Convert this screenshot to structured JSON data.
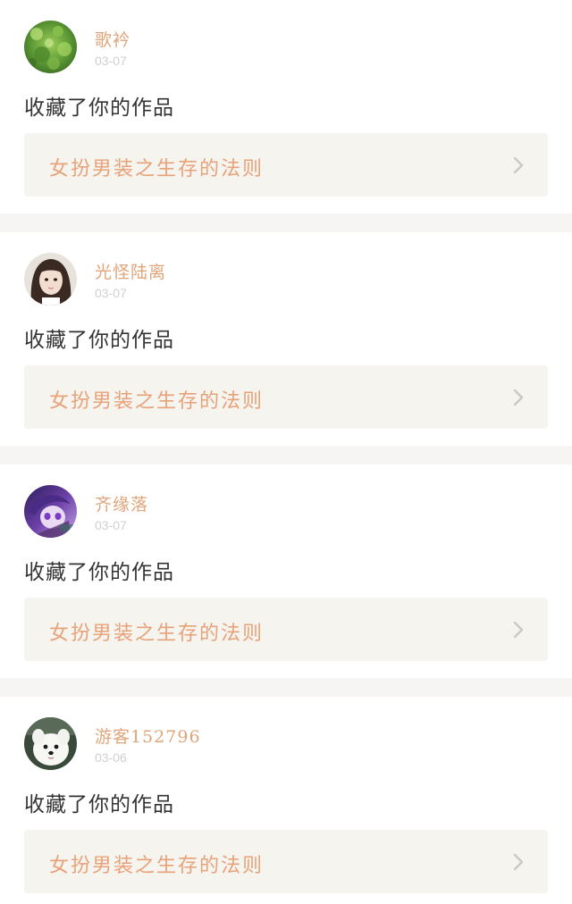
{
  "feed": {
    "items": [
      {
        "user_name": "歌衿",
        "date": "03-07",
        "action": "收藏了你的作品",
        "work_title": "女扮男装之生存的法则",
        "avatar_icon": "green-foliage-avatar-icon"
      },
      {
        "user_name": "光怪陆离",
        "date": "03-07",
        "action": "收藏了你的作品",
        "work_title": "女扮男装之生存的法则",
        "avatar_icon": "girl-portrait-avatar-icon"
      },
      {
        "user_name": "齐缘落",
        "date": "03-07",
        "action": "收藏了你的作品",
        "work_title": "女扮男装之生存的法则",
        "avatar_icon": "anime-purple-avatar-icon"
      },
      {
        "user_name": "游客152796",
        "date": "03-06",
        "action": "收藏了你的作品",
        "work_title": "女扮男装之生存的法则",
        "avatar_icon": "white-puppy-avatar-icon"
      }
    ]
  },
  "colors": {
    "name": "#e0a57a",
    "date": "#cfcfcf",
    "action": "#333333",
    "link_bg": "#f5f4ee",
    "link_text": "#e8a27a",
    "separator": "#f7f5f3",
    "chevron": "#c8c8c8"
  }
}
